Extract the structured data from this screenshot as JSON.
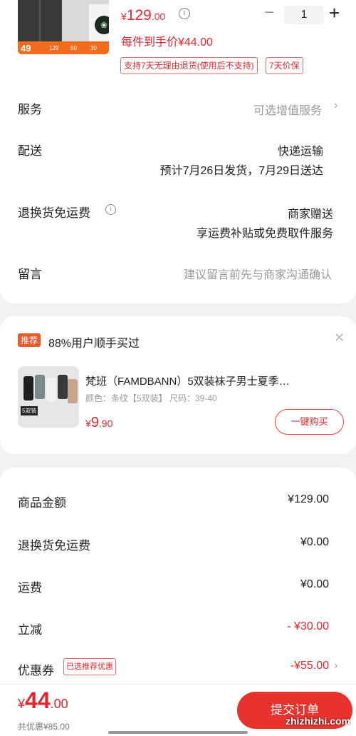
{
  "product": {
    "thumb_badge": "49",
    "thumb_prices": [
      "129",
      "50",
      "30"
    ],
    "price_symbol": "¥",
    "price_int": "129",
    "price_dec": ".00",
    "quantity": "1",
    "unit_price": "每件到手价¥44.00",
    "tags": [
      "支持7天无理由退货(使用后不支持)",
      "7天价保"
    ]
  },
  "rows": {
    "service_label": "服务",
    "service_value": "可选增值服务",
    "delivery_label": "配送",
    "delivery_value": "快递运输",
    "delivery_eta": "预计7月26日发货，7月29日送达",
    "return_label": "退换货免运费",
    "return_value": "商家赠送",
    "return_detail": "享运费补贴或免费取件服务",
    "note_label": "留言",
    "note_placeholder": "建议留言前先与商家沟通确认"
  },
  "recommend": {
    "tag": "推荐",
    "title": "88%用户顺手买过",
    "img_label": "5双装",
    "name": "梵班（FAMDBANN）5双装袜子男士夏季…",
    "spec": "颜色：条纹【5双装】   尺码：39-40",
    "price_symbol": "¥",
    "price_int": "9",
    "price_dec": ".90",
    "button": "一键购买"
  },
  "summary": {
    "items": [
      {
        "label": "商品金额",
        "value": "¥129.00"
      },
      {
        "label": "退换货免运费",
        "value": "¥0.00"
      },
      {
        "label": "运费",
        "value": "¥0.00"
      },
      {
        "label": "立减",
        "value": "- ¥30.00"
      },
      {
        "label": "优惠券",
        "value": "-¥55.00"
      }
    ],
    "coupon_tag": "已选推荐优惠"
  },
  "bottom": {
    "total_symbol": "¥",
    "total_int": "44",
    "total_dec": ".00",
    "saved": "共优惠¥85.00",
    "submit": "提交订单"
  },
  "watermark": "zhizhizhi.com",
  "colors": {
    "accent": "#e4262e",
    "background": "#f2f2f2"
  }
}
